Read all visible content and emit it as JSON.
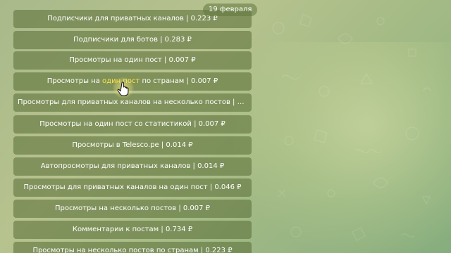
{
  "chat": {
    "date_badge": "19 февраля"
  },
  "keyboard": {
    "buttons": [
      {
        "label": "Подписчики для приватных каналов | 0.223 ₽"
      },
      {
        "label": "Подписчики для ботов | 0.283 ₽"
      },
      {
        "label": "Просмотры на один пост | 0.007 ₽"
      },
      {
        "label_pre": "Просмотры на ",
        "label_hl": "один пост",
        "label_post": " по странам | 0.007 ₽"
      },
      {
        "label": "Просмотры для приватных каналов на несколько постов | 0...."
      },
      {
        "label": "Просмотры на один пост со статистикой | 0.007 ₽"
      },
      {
        "label": "Просмотры в Telesco.pe | 0.014 ₽"
      },
      {
        "label": "Автопросмотры для приватных каналов | 0.014 ₽"
      },
      {
        "label": "Просмотры для приватных каналов на один пост | 0.046 ₽"
      },
      {
        "label": "Просмотры на несколько постов | 0.007 ₽"
      },
      {
        "label": "Комментарии к постам | 0.734 ₽"
      },
      {
        "label": "Просмотры на несколько постов по странам | 0.223 ₽"
      }
    ]
  },
  "colors": {
    "button_bg": "#586c34",
    "highlight_text": "#ffe34a",
    "background": "#a9b98a"
  },
  "icons": {
    "cursor": "hand-pointer-icon"
  }
}
